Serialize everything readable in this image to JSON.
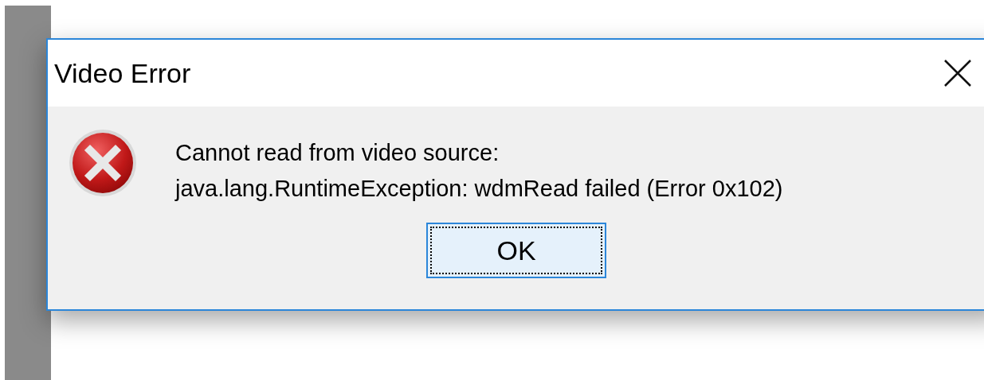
{
  "dialog": {
    "title": "Video Error",
    "message_lines": [
      "Cannot read from video source:",
      "java.lang.RuntimeException: wdmRead failed (Error 0x102)"
    ],
    "buttons": [
      {
        "label": "OK",
        "focused": true
      }
    ]
  }
}
